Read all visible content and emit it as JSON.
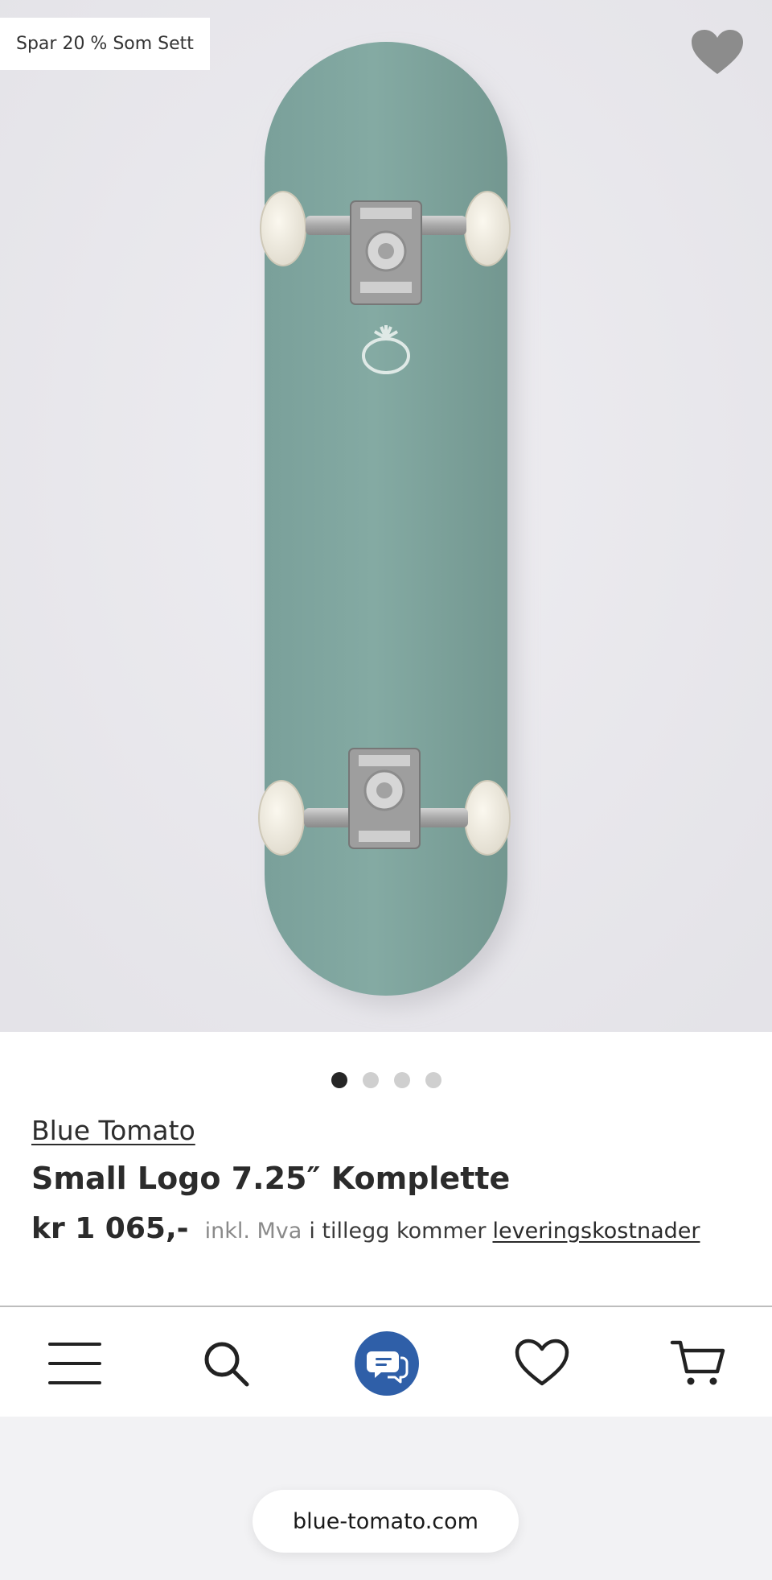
{
  "product_image": {
    "badge": "Spar 20 % Som Sett",
    "favorite_icon": "heart-filled-icon",
    "deck_color": "#7ea39c",
    "slide_count": 4,
    "active_slide": 1
  },
  "product": {
    "brand": "Blue Tomato",
    "title": "Small Logo 7.25″ Komplette",
    "price": "kr 1 065,-",
    "vat_note": "inkl. Mva",
    "extra_note": "i tillegg kommer",
    "shipping_link": "leveringskostnader"
  },
  "bottom_nav": {
    "items": [
      {
        "name": "menu",
        "icon": "hamburger-menu-icon"
      },
      {
        "name": "search",
        "icon": "search-icon"
      },
      {
        "name": "chat",
        "icon": "chat-bubbles-icon",
        "accent": "#2f5fa8"
      },
      {
        "name": "wishlist",
        "icon": "heart-outline-icon"
      },
      {
        "name": "cart",
        "icon": "cart-icon"
      }
    ]
  },
  "browser": {
    "url": "blue-tomato.com"
  }
}
